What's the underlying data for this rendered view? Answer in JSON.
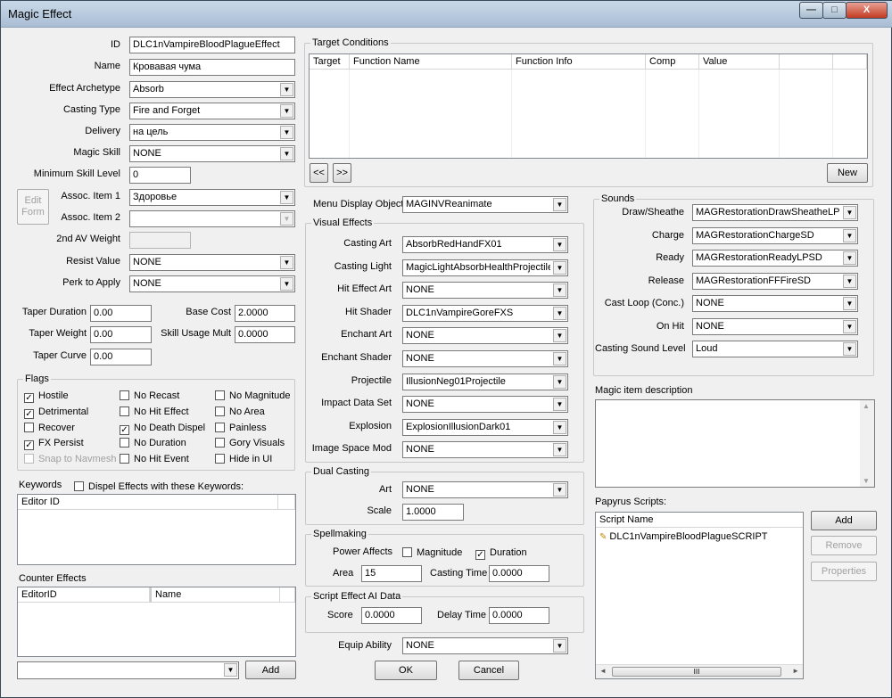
{
  "window": {
    "title": "Magic Effect",
    "min": "—",
    "max": "□",
    "close": "X"
  },
  "fields": {
    "id_label": "ID",
    "id": "DLC1nVampireBloodPlagueEffect",
    "name_label": "Name",
    "name": "Кровавая чума",
    "archetype_label": "Effect Archetype",
    "archetype": "Absorb",
    "casting_type_label": "Casting Type",
    "casting_type": "Fire and Forget",
    "delivery_label": "Delivery",
    "delivery": "на цель",
    "magic_skill_label": "Magic Skill",
    "magic_skill": "NONE",
    "min_skill_label": "Minimum Skill Level",
    "min_skill": "0",
    "edit_form": "Edit Form",
    "assoc1_label": "Assoc. Item 1",
    "assoc1": "Здоровье",
    "assoc2_label": "Assoc. Item 2",
    "assoc2": "",
    "av_weight_label": "2nd AV Weight",
    "resist_label": "Resist Value",
    "resist": "NONE",
    "perk_label": "Perk to Apply",
    "perk": "NONE",
    "taper_dur_label": "Taper Duration",
    "taper_dur": "0.00",
    "base_cost_label": "Base Cost",
    "base_cost": "2.0000",
    "taper_weight_label": "Taper Weight",
    "taper_weight": "0.00",
    "skill_mult_label": "Skill Usage Mult",
    "skill_mult": "0.0000",
    "taper_curve_label": "Taper Curve",
    "taper_curve": "0.00"
  },
  "flags": {
    "title": "Flags",
    "items": [
      {
        "label": "Hostile",
        "checked": true,
        "disabled": false
      },
      {
        "label": "No Recast",
        "checked": false,
        "disabled": false
      },
      {
        "label": "No Magnitude",
        "checked": false,
        "disabled": false
      },
      {
        "label": "Detrimental",
        "checked": true,
        "disabled": false
      },
      {
        "label": "No Hit Effect",
        "checked": false,
        "disabled": false
      },
      {
        "label": "No Area",
        "checked": false,
        "disabled": false
      },
      {
        "label": "Recover",
        "checked": false,
        "disabled": false
      },
      {
        "label": "No Death Dispel",
        "checked": true,
        "disabled": false
      },
      {
        "label": "Painless",
        "checked": false,
        "disabled": false
      },
      {
        "label": "FX Persist",
        "checked": true,
        "disabled": false
      },
      {
        "label": "No Duration",
        "checked": false,
        "disabled": false
      },
      {
        "label": "Gory Visuals",
        "checked": false,
        "disabled": false
      },
      {
        "label": "Snap to Navmesh",
        "checked": false,
        "disabled": true
      },
      {
        "label": "No Hit Event",
        "checked": false,
        "disabled": false
      },
      {
        "label": "Hide in UI",
        "checked": false,
        "disabled": false
      }
    ]
  },
  "keywords": {
    "label": "Keywords",
    "dispel_label": "Dispel Effects with these Keywords:",
    "col": "Editor ID"
  },
  "counter": {
    "label": "Counter Effects",
    "col1": "EditorID",
    "col2": "Name",
    "add": "Add"
  },
  "target": {
    "title": "Target Conditions",
    "cols": [
      "Target",
      "Function Name",
      "Function Info",
      "Comp",
      "Value"
    ],
    "prev": "<<",
    "next": ">>",
    "new": "New"
  },
  "menu_display": {
    "label": "Menu Display Object",
    "value": "MAGINVReanimate"
  },
  "visual": {
    "title": "Visual Effects",
    "rows": [
      {
        "label": "Casting Art",
        "value": "AbsorbRedHandFX01"
      },
      {
        "label": "Casting Light",
        "value": "MagicLightAbsorbHealthProjectile"
      },
      {
        "label": "Hit Effect Art",
        "value": "NONE"
      },
      {
        "label": "Hit Shader",
        "value": "DLC1nVampireGoreFXS"
      },
      {
        "label": "Enchant Art",
        "value": "NONE"
      },
      {
        "label": "Enchant Shader",
        "value": "NONE"
      },
      {
        "label": "Projectile",
        "value": "IllusionNeg01Projectile"
      },
      {
        "label": "Impact Data Set",
        "value": "NONE"
      },
      {
        "label": "Explosion",
        "value": "ExplosionIllusionDark01"
      },
      {
        "label": "Image Space Mod",
        "value": "NONE"
      }
    ]
  },
  "dual": {
    "title": "Dual Casting",
    "art_label": "Art",
    "art": "NONE",
    "scale_label": "Scale",
    "scale": "1.0000"
  },
  "spell": {
    "title": "Spellmaking",
    "power_label": "Power Affects",
    "magnitude": "Magnitude",
    "duration": "Duration",
    "area_label": "Area",
    "area": "15",
    "cast_time_label": "Casting Time",
    "cast_time": "0.0000"
  },
  "ai": {
    "title": "Script Effect AI Data",
    "score_label": "Score",
    "score": "0.0000",
    "delay_label": "Delay Time",
    "delay": "0.0000"
  },
  "equip": {
    "label": "Equip Ability",
    "value": "NONE"
  },
  "ok": "OK",
  "cancel": "Cancel",
  "sounds": {
    "title": "Sounds",
    "rows": [
      {
        "label": "Draw/Sheathe",
        "value": "MAGRestorationDrawSheatheLPMSD"
      },
      {
        "label": "Charge",
        "value": "MAGRestorationChargeSD"
      },
      {
        "label": "Ready",
        "value": "MAGRestorationReadyLPSD"
      },
      {
        "label": "Release",
        "value": "MAGRestorationFFFireSD"
      },
      {
        "label": "Cast Loop (Conc.)",
        "value": "NONE"
      },
      {
        "label": "On Hit",
        "value": "NONE"
      },
      {
        "label": "Casting Sound Level",
        "value": "Loud"
      }
    ]
  },
  "desc": {
    "label": "Magic item description"
  },
  "papyrus": {
    "label": "Papyrus Scripts:",
    "col": "Script Name",
    "script": "DLC1nVampireBloodPlagueSCRIPT",
    "add": "Add",
    "remove": "Remove",
    "properties": "Properties",
    "hscroll": "III"
  }
}
